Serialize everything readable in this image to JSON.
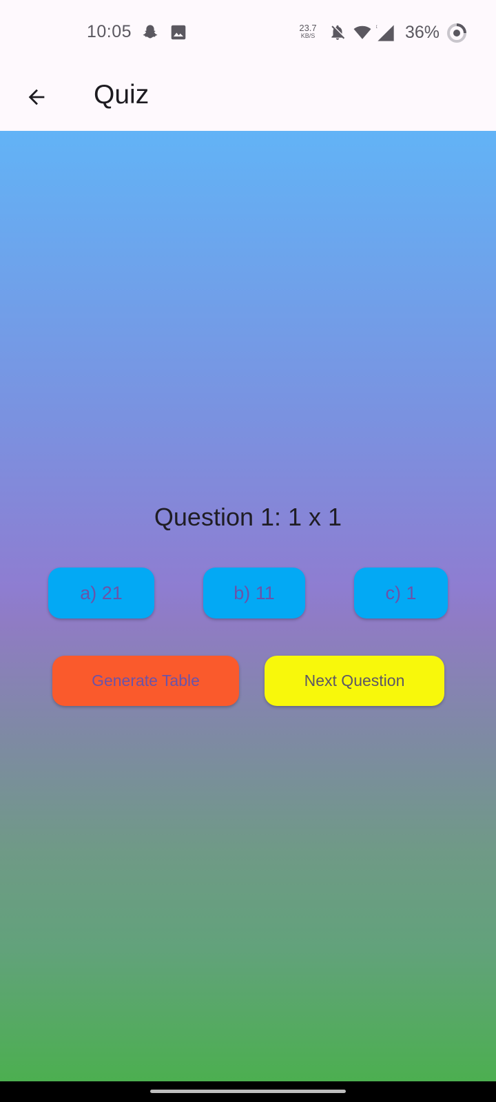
{
  "status_bar": {
    "time": "10:05",
    "net_speed_value": "23.7",
    "net_speed_unit": "KB/S",
    "battery": "36%",
    "icons": [
      "snapchat-icon",
      "image-icon",
      "bell-off-icon",
      "wifi-icon",
      "signal-icon",
      "battery-saver-icon"
    ]
  },
  "app_bar": {
    "back_icon": "arrow-left-icon",
    "title": "Quiz"
  },
  "quiz": {
    "question": "Question 1: 1 x 1",
    "answers": [
      {
        "label": "a) 21"
      },
      {
        "label": "b) 11"
      },
      {
        "label": "c) 1"
      }
    ],
    "generate_label": "Generate Table",
    "next_label": "Next Question"
  },
  "colors": {
    "answer_button": "#03a9f4",
    "generate_button": "#fa5a2c",
    "next_button": "#f8f80b",
    "gradient_top": "#62b3f6",
    "gradient_bottom": "#4caf50"
  }
}
